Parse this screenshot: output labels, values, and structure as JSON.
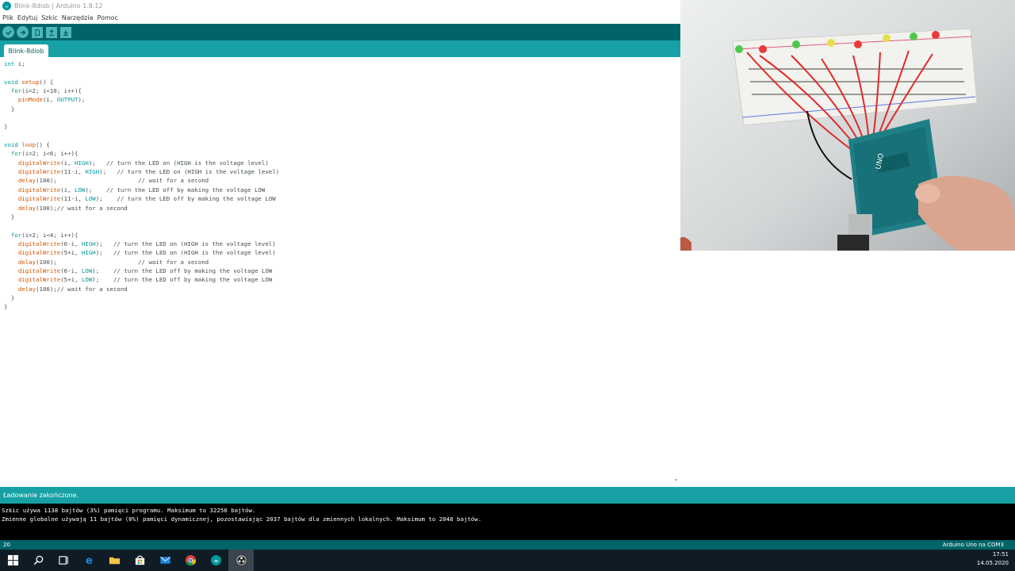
{
  "window": {
    "title": "Blink-8diob | Arduino 1.8.12"
  },
  "menu": {
    "items": [
      "Plik",
      "Edytuj",
      "Szkic",
      "Narzędzia",
      "Pomoc"
    ]
  },
  "toolbar": {
    "buttons": [
      "verify-icon",
      "upload-icon",
      "new-icon",
      "open-icon",
      "save-icon"
    ]
  },
  "tabs": {
    "active": "Blink-8diob"
  },
  "editor": {
    "lines": [
      "int i;",
      "",
      "void setup() {",
      "  for(i=2; i<10; i++){",
      "    pinMode(i, OUTPUT);",
      "  }",
      "",
      "}",
      "",
      "void loop() {",
      "  for(i=2; i<6; i++){",
      "    digitalWrite(i, HIGH);   // turn the LED on (HIGH is the voltage level)",
      "    digitalWrite(11-i, HIGH);   // turn the LED on (HIGH is the voltage level)",
      "    delay(100);                       // wait for a second",
      "    digitalWrite(i, LOW);    // turn the LED off by making the voltage LOW",
      "    digitalWrite(11-i, LOW);    // turn the LED off by making the voltage LOW",
      "    delay(100);// wait for a second",
      "  }",
      "",
      "  for(i=2; i<4; i++){",
      "    digitalWrite(6-i, HIGH);   // turn the LED on (HIGH is the voltage level)",
      "    digitalWrite(5+i, HIGH);   // turn the LED on (HIGH is the voltage level)",
      "    delay(100);                       // wait for a second",
      "    digitalWrite(6-i, LOW);    // turn the LED off by making the voltage LOW",
      "    digitalWrite(5+i, LOW);    // turn the LED off by making the voltage LOW",
      "    delay(100);// wait for a second",
      "  }",
      "}"
    ]
  },
  "status": {
    "message": "Ładowanie zakończone."
  },
  "console": {
    "lines": [
      "Szkic używa 1138 bajtów (3%) pamięci programu. Maksimum to 32256 bajtów.",
      "Zmienne globalne używają 11 bajtów (0%) pamięci dynamicznej, pozostawiając 2037 bajtów dla zmiennych lokalnych. Maksimum to 2048 bajtów."
    ]
  },
  "bottom": {
    "line_number": "20",
    "board": "Arduino Uno na COM3"
  },
  "taskbar": {
    "time": "17:51",
    "date": "14.05.2020"
  },
  "colors": {
    "toolbar": "#006468",
    "tabrow": "#17a1a5",
    "keyword": "#00979c",
    "function": "#d35400"
  }
}
